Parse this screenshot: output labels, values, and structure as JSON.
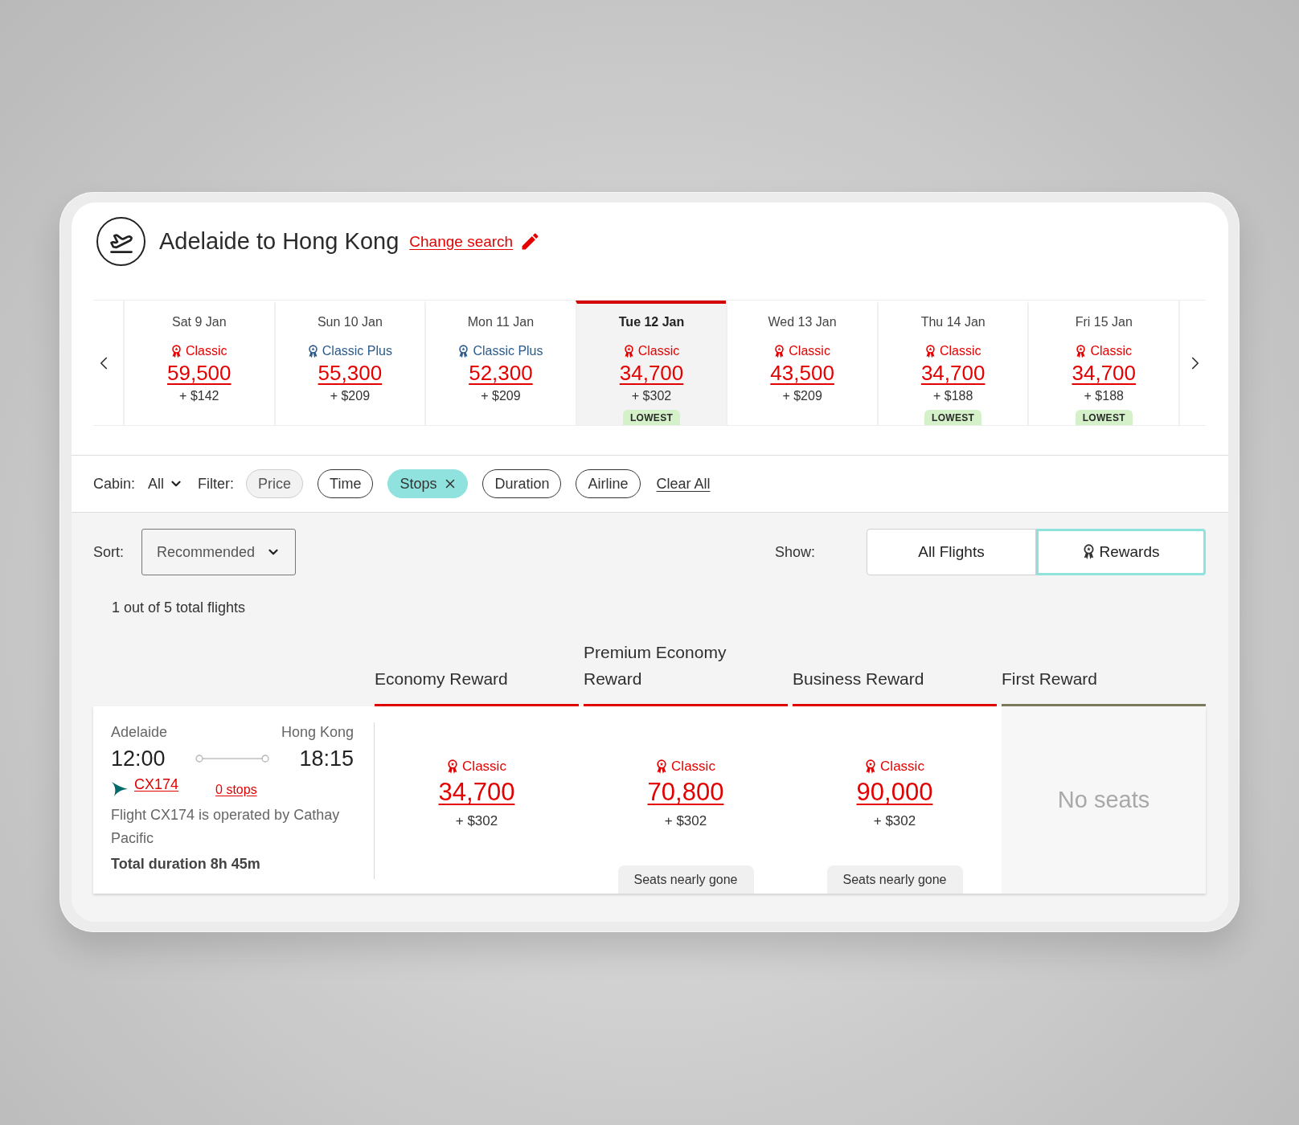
{
  "header": {
    "title": "Adelaide to Hong Kong",
    "change_search": "Change search"
  },
  "date_strip": {
    "days": [
      {
        "date": "Sat 9 Jan",
        "kind": "classic",
        "fare_type": "Classic",
        "points": "59,500",
        "tax": "+ $142",
        "selected": false
      },
      {
        "date": "Sun 10 Jan",
        "kind": "classic-plus",
        "fare_type": "Classic Plus",
        "points": "55,300",
        "tax": "+ $209",
        "selected": false
      },
      {
        "date": "Mon 11 Jan",
        "kind": "classic-plus",
        "fare_type": "Classic Plus",
        "points": "52,300",
        "tax": "+ $209",
        "selected": false
      },
      {
        "date": "Tue 12 Jan",
        "kind": "classic",
        "fare_type": "Classic",
        "points": "34,700",
        "tax": "+ $302",
        "badge": "LOWEST",
        "selected": true
      },
      {
        "date": "Wed 13 Jan",
        "kind": "classic",
        "fare_type": "Classic",
        "points": "43,500",
        "tax": "+ $209",
        "selected": false
      },
      {
        "date": "Thu 14 Jan",
        "kind": "classic",
        "fare_type": "Classic",
        "points": "34,700",
        "tax": "+ $188",
        "badge": "LOWEST",
        "selected": false
      },
      {
        "date": "Fri 15 Jan",
        "kind": "classic",
        "fare_type": "Classic",
        "points": "34,700",
        "tax": "+ $188",
        "badge": "LOWEST",
        "selected": false
      }
    ]
  },
  "filters": {
    "cabin_label": "Cabin:",
    "cabin_value": "All",
    "filter_label": "Filter:",
    "chips": [
      {
        "label": "Price",
        "selected": false,
        "disabled": true
      },
      {
        "label": "Time",
        "selected": false,
        "disabled": false
      },
      {
        "label": "Stops",
        "selected": true,
        "disabled": false
      },
      {
        "label": "Duration",
        "selected": false,
        "disabled": false
      },
      {
        "label": "Airline",
        "selected": false,
        "disabled": false
      }
    ],
    "clear_all": "Clear All"
  },
  "sort": {
    "label": "Sort:",
    "value": "Recommended"
  },
  "show": {
    "label": "Show:",
    "options": [
      {
        "label": "All Flights",
        "kind": "plain",
        "selected": false
      },
      {
        "label": "Rewards",
        "kind": "reward",
        "selected": true
      }
    ]
  },
  "result_count": "1 out of 5 total flights",
  "columns": [
    {
      "label": "Economy Reward",
      "available": true
    },
    {
      "label": "Premium Economy Reward",
      "available": true
    },
    {
      "label": "Business Reward",
      "available": true
    },
    {
      "label": "First Reward",
      "available": false
    }
  ],
  "flights": [
    {
      "origin": "Adelaide",
      "destination": "Hong Kong",
      "depart": "12:00",
      "arrive": "18:15",
      "flight_number": "CX174",
      "stops": "0 stops",
      "operated_by": "Flight CX174 is operated by Cathay Pacific",
      "duration": "Total duration 8h 45m",
      "fares": [
        {
          "kind": "classic",
          "fare_type": "Classic",
          "points": "34,700",
          "tax": "+ $302"
        },
        {
          "kind": "classic",
          "fare_type": "Classic",
          "points": "70,800",
          "tax": "+ $302",
          "note": "Seats nearly gone"
        },
        {
          "kind": "classic",
          "fare_type": "Classic",
          "points": "90,000",
          "tax": "+ $302",
          "note": "Seats nearly gone"
        },
        {
          "kind": "unavailable",
          "text": "No seats"
        }
      ]
    }
  ]
}
